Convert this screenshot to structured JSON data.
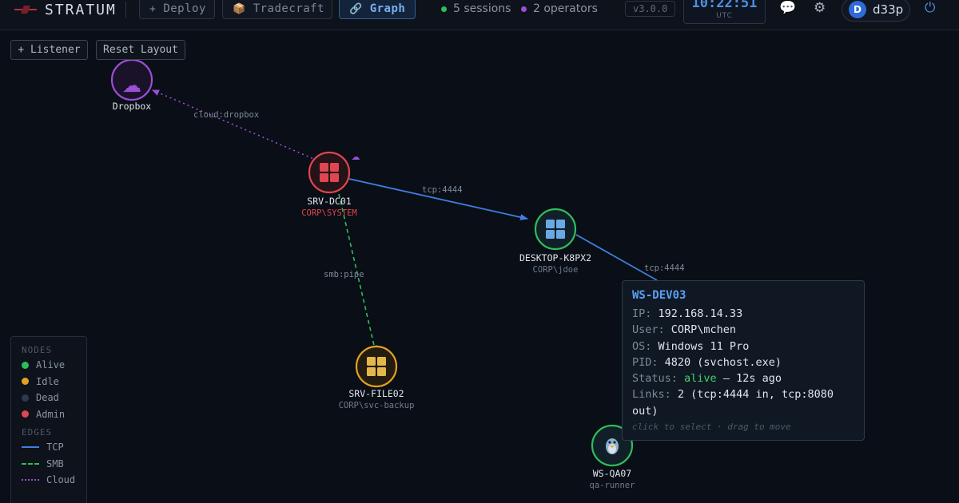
{
  "header": {
    "brand": "STRATUM",
    "nav": [
      {
        "icon": "plus-icon",
        "glyph": "+",
        "label": "Deploy"
      },
      {
        "icon": "package-icon",
        "glyph": "📦",
        "label": "Tradecraft"
      },
      {
        "icon": "link-icon",
        "glyph": "🔗",
        "label": "Graph",
        "active": true
      }
    ],
    "sessions": "5 sessions",
    "operators": "2 operators",
    "version": "v3.0.0",
    "clock_time": "10:22:51",
    "clock_zone": "UTC",
    "user_initial": "D",
    "username": "d33p"
  },
  "colors": {
    "tcp": "#3f7fe0",
    "smb": "#2ebd5a",
    "cloud": "#9a4fd6",
    "alive": "#2ebd5a",
    "idle": "#e3a21f",
    "dead": "#2d3a4b",
    "admin": "#e0464f"
  },
  "toolbar": {
    "listener_label": "+ Listener",
    "reset_label": "Reset Layout"
  },
  "graph": {
    "nodes": [
      {
        "id": "dropbox",
        "name": "Dropbox",
        "user": "",
        "icon": "cloud-icon",
        "status": "cloud"
      },
      {
        "id": "srv-dc01",
        "name": "SRV-DC01",
        "user": "CORP\\SYSTEM",
        "icon": "windows-icon",
        "status": "admin"
      },
      {
        "id": "desktop-k8px2",
        "name": "DESKTOP-K8PX2",
        "user": "CORP\\jdoe",
        "icon": "windows-icon",
        "status": "alive"
      },
      {
        "id": "srv-file02",
        "name": "SRV-FILE02",
        "user": "CORP\\svc-backup",
        "icon": "windows-icon",
        "status": "idle"
      },
      {
        "id": "ws-qa07",
        "name": "WS-QA07",
        "user": "qa-runner",
        "icon": "linux-icon",
        "status": "alive"
      }
    ],
    "edges": [
      {
        "from": "srv-dc01",
        "to": "dropbox",
        "label": "cloud:dropbox",
        "type": "cloud"
      },
      {
        "from": "srv-dc01",
        "to": "desktop-k8px2",
        "label": "tcp:4444",
        "type": "tcp"
      },
      {
        "from": "srv-dc01",
        "to": "srv-file02",
        "label": "smb:pipe",
        "type": "smb"
      },
      {
        "from": "desktop-k8px2",
        "to": "ws-dev03",
        "label": "tcp:4444",
        "type": "tcp"
      }
    ]
  },
  "legend": {
    "nodes_title": "NODES",
    "nodes": [
      "Alive",
      "Idle",
      "Dead",
      "Admin"
    ],
    "edges_title": "EDGES",
    "edges": [
      "TCP",
      "SMB",
      "Cloud"
    ]
  },
  "tooltip": {
    "title": "WS-DEV03",
    "ip_key": "IP:",
    "ip": "192.168.14.33",
    "user_key": "User:",
    "user": "CORP\\mchen",
    "os_key": "OS:",
    "os": "Windows 11 Pro",
    "pid_key": "PID:",
    "pid": "4820 (svchost.exe)",
    "status_key": "Status:",
    "status": "alive",
    "status_age": "— 12s ago",
    "links_key": "Links:",
    "links": "2 (tcp:4444 in, tcp:8080 out)",
    "hint": "click to select · drag to move"
  }
}
